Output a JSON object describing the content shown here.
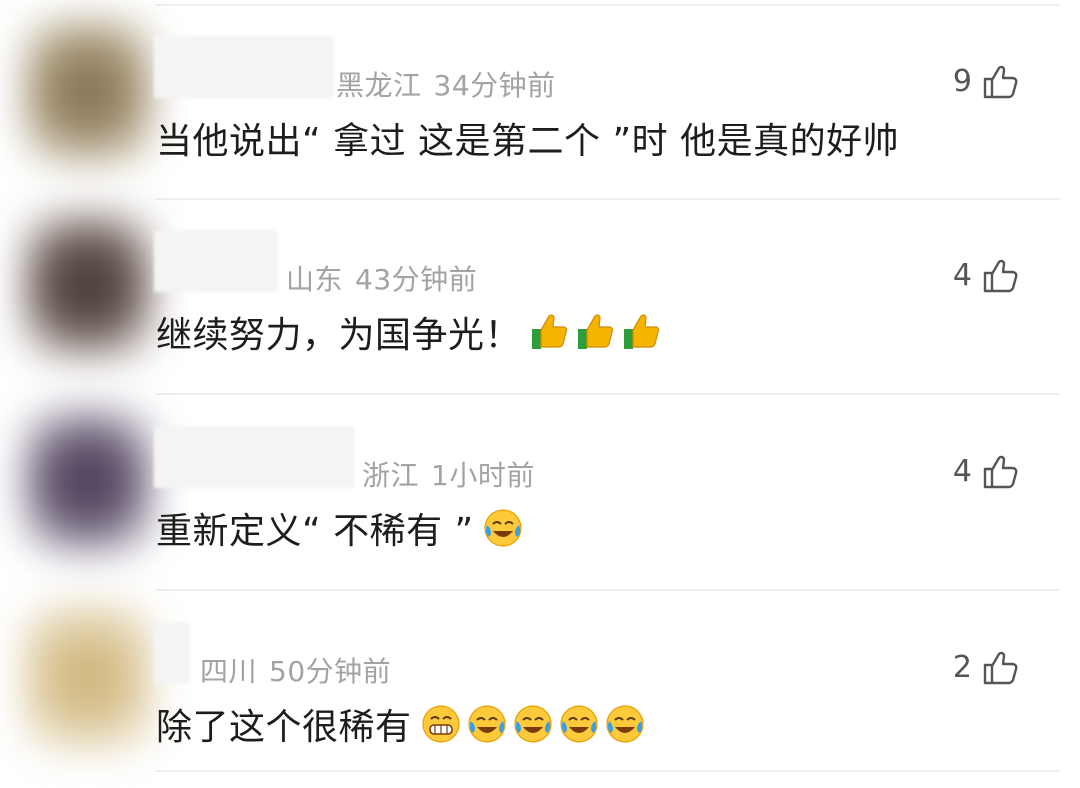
{
  "comments": [
    {
      "region": "黑龙江",
      "time": "34分钟前",
      "likes": "9",
      "text": "当他说出“ 拿过 这是第二个 ”时 他是真的好帅",
      "emojis": [],
      "avatar_color": "#8a7a55",
      "name_blurred": true
    },
    {
      "region": "山东",
      "time": "43分钟前",
      "likes": "4",
      "text": "继续努力，为国争光！",
      "emojis": [
        "thumbs-up",
        "thumbs-up",
        "thumbs-up"
      ],
      "avatar_color": "#4a3c36",
      "name_blurred": true
    },
    {
      "region": "浙江",
      "time": "1小时前",
      "likes": "4",
      "text": "重新定义“ 不稀有 ”",
      "emojis": [
        "laughing-crying"
      ],
      "avatar_color": "#4e4258",
      "name_blurred": true
    },
    {
      "region": "四川",
      "time": "50分钟前",
      "likes": "2",
      "text": "除了这个很稀有",
      "emojis": [
        "grinning",
        "laughing-crying",
        "laughing-crying",
        "laughing-crying",
        "laughing-crying"
      ],
      "avatar_color": "#d4bb86",
      "name_blurred": true
    }
  ],
  "colors": {
    "meta": "#a3a3a3",
    "text": "#1d1d1d",
    "divider": "#efefef"
  }
}
